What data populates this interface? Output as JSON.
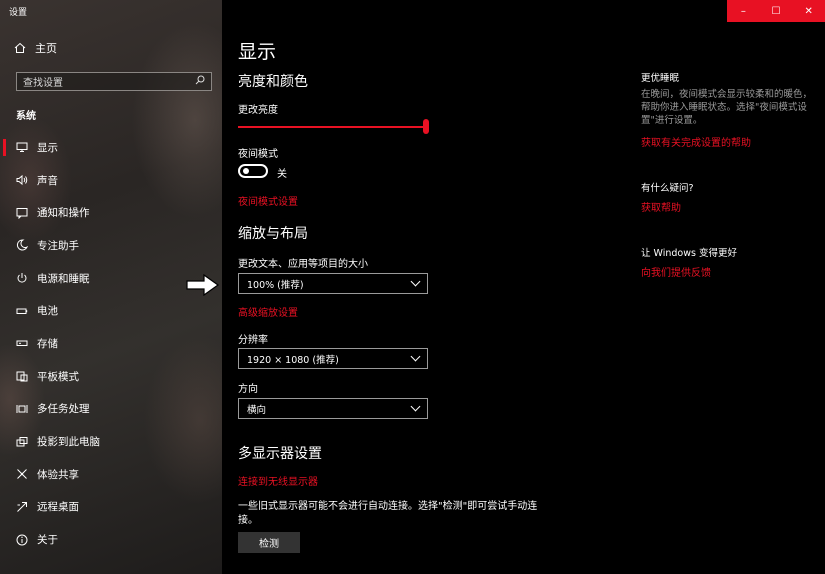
{
  "window": {
    "title": "设置",
    "controls": [
      "–",
      "☐",
      "✕"
    ]
  },
  "sidebar": {
    "home_label": "主页",
    "search_placeholder": "查找设置",
    "section": "系统",
    "items": [
      {
        "label": "显示",
        "icon": "monitor-icon"
      },
      {
        "label": "声音",
        "icon": "speaker-icon"
      },
      {
        "label": "通知和操作",
        "icon": "notification-icon"
      },
      {
        "label": "专注助手",
        "icon": "moon-icon"
      },
      {
        "label": "电源和睡眠",
        "icon": "power-icon"
      },
      {
        "label": "电池",
        "icon": "battery-icon"
      },
      {
        "label": "存储",
        "icon": "storage-icon"
      },
      {
        "label": "平板模式",
        "icon": "tablet-icon"
      },
      {
        "label": "多任务处理",
        "icon": "multitask-icon"
      },
      {
        "label": "投影到此电脑",
        "icon": "project-icon"
      },
      {
        "label": "体验共享",
        "icon": "share-icon"
      },
      {
        "label": "远程桌面",
        "icon": "remote-icon"
      },
      {
        "label": "关于",
        "icon": "info-icon"
      }
    ]
  },
  "main": {
    "title": "显示",
    "brightness": {
      "heading": "亮度和颜色",
      "label": "更改亮度",
      "value": 100,
      "night_label": "夜间模式",
      "night_state": "关",
      "night_link": "夜间模式设置"
    },
    "scale": {
      "heading": "缩放与布局",
      "size_label": "更改文本、应用等项目的大小",
      "size_value": "100% (推荐)",
      "advanced_link": "高级缩放设置",
      "res_label": "分辨率",
      "res_value": "1920 × 1080 (推荐)",
      "orient_label": "方向",
      "orient_value": "横向"
    },
    "multi": {
      "heading": "多显示器设置",
      "link": "连接到无线显示器",
      "desc": "一些旧式显示器可能不会进行自动连接。选择\"检测\"即可尝试手动连接。",
      "button": "检测"
    }
  },
  "right": {
    "sleep_heading": "更优睡眠",
    "sleep_text": "在晚间，夜间模式会显示较柔和的暖色，帮助你进入睡眠状态。选择\"夜间模式设置\"进行设置。",
    "sleep_link": "获取有关完成设置的帮助",
    "question_heading": "有什么疑问?",
    "question_link": "获取帮助",
    "better_heading": "让 Windows 变得更好",
    "better_link": "向我们提供反馈"
  }
}
